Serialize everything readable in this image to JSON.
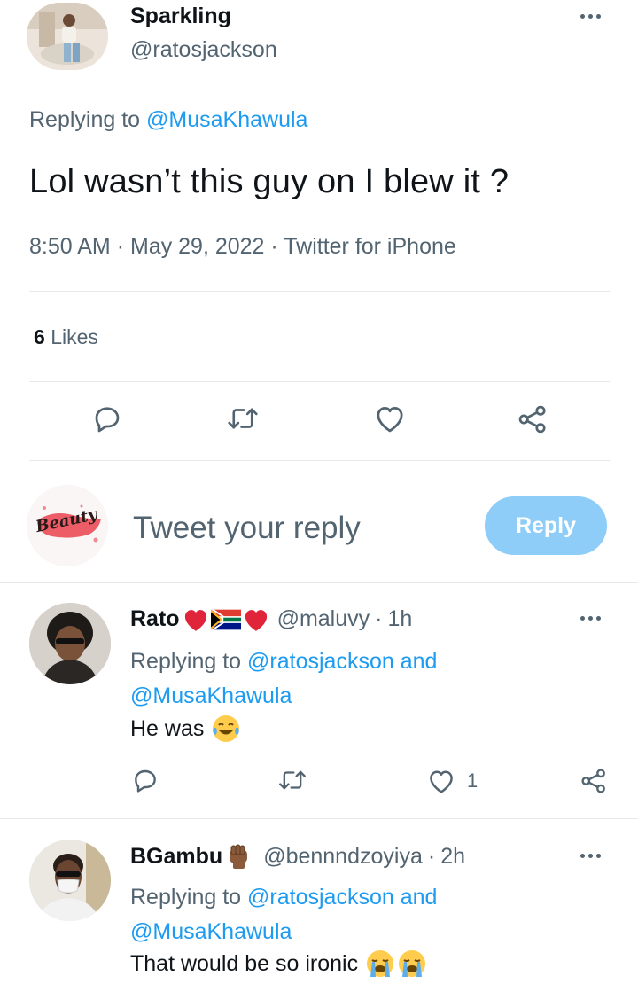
{
  "main_tweet": {
    "display_name": "Sparkling",
    "handle": "@ratosjackson",
    "replying_prefix": "Replying to",
    "replying_to": "@MusaKhawula",
    "text": "Lol wasn’t this guy on I blew it ?",
    "time": "8:50 AM",
    "date": "May 29, 2022",
    "source": "Twitter for iPhone",
    "likes_count": "6",
    "likes_label": "Likes"
  },
  "composer": {
    "avatar_text": "Beauty",
    "placeholder": "Tweet your reply",
    "button_label": "Reply"
  },
  "replies": [
    {
      "name": "Rato",
      "handle": "@maluvy",
      "time": "1h",
      "replying_prefix": "Replying to",
      "mention_1": "@ratosjackson",
      "and": "and",
      "mention_2": "@MusaKhawula",
      "text": "He was",
      "like_count": "1"
    },
    {
      "name": "BGambu",
      "handle": "@bennndzoyiya",
      "time": "2h",
      "replying_prefix": "Replying to",
      "mention_1": "@ratosjackson",
      "and": "and",
      "mention_2": "@MusaKhawula",
      "text": "That would be so ironic"
    }
  ],
  "separator": "·",
  "colors": {
    "accent": "#1d9bf0",
    "reply_button_disabled": "#8ecdf7",
    "muted_text": "#536471",
    "heart_red": "#e0243a"
  }
}
